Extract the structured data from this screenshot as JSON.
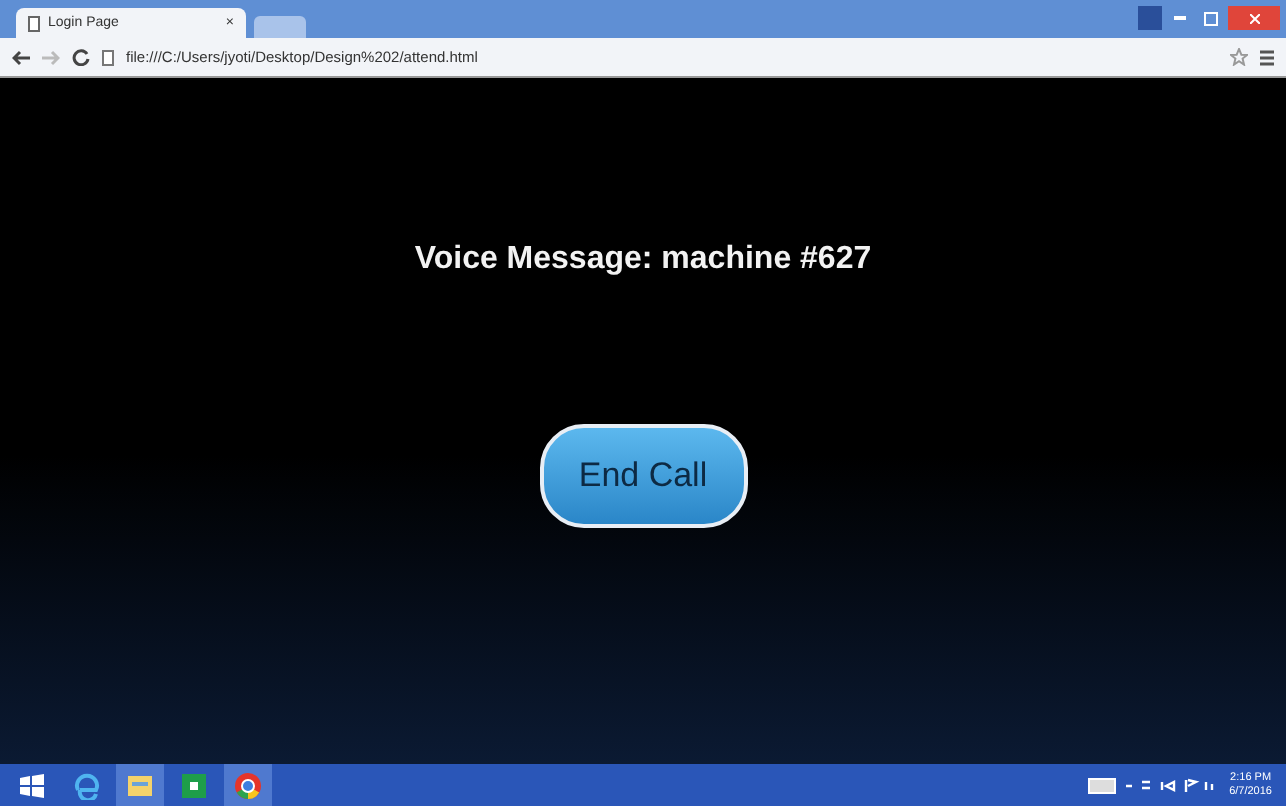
{
  "browser": {
    "tab": {
      "title": "Login Page",
      "close": "×"
    },
    "address": "file:///C:/Users/jyoti/Desktop/Design%202/attend.html"
  },
  "page": {
    "heading": "Voice Message: machine #627",
    "button": "End Call"
  },
  "taskbar": {
    "apps": [
      {
        "kind": "ie",
        "selected": false
      },
      {
        "kind": "files",
        "selected": true
      },
      {
        "kind": "store",
        "selected": false
      },
      {
        "kind": "chrome",
        "selected": true
      }
    ],
    "time": "2:16 PM",
    "date": "6/7/2016"
  }
}
